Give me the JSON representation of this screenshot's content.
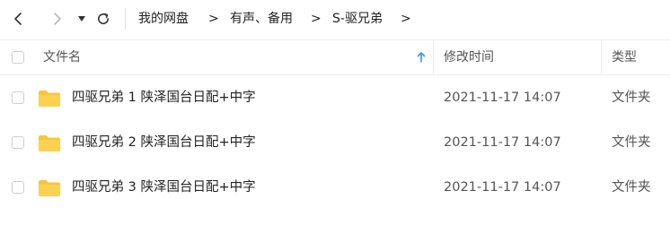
{
  "nav": {
    "breadcrumbs": [
      "我的网盘",
      "有声、备用",
      "S-驱兄弟"
    ],
    "separator": ">"
  },
  "table": {
    "columns": {
      "name": "文件名",
      "modified": "修改时间",
      "type": "类型"
    },
    "sort": {
      "column": "name",
      "direction": "ascending",
      "icon": "arrow-up-icon"
    },
    "rows": [
      {
        "name": "四驱兄弟 1 陕泽国台日配+中字",
        "modified": "2021-11-17 14:07",
        "type": "文件夹"
      },
      {
        "name": "四驱兄弟 2 陕泽国台日配+中字",
        "modified": "2021-11-17 14:07",
        "type": "文件夹"
      },
      {
        "name": "四驱兄弟 3 陕泽国台日配+中字",
        "modified": "2021-11-17 14:07",
        "type": "文件夹"
      }
    ]
  },
  "colors": {
    "folder": "#f9c53a",
    "sort_arrow": "#2f9bf0",
    "divider": "#eeeeee"
  }
}
